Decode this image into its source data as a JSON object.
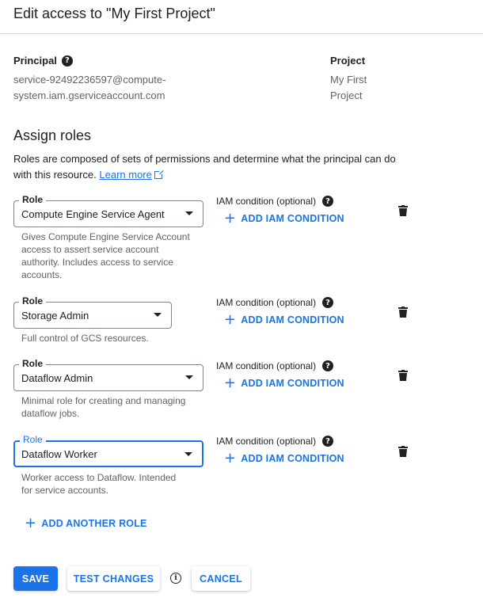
{
  "dialog": {
    "title": "Edit access to \"My First Project\""
  },
  "principal": {
    "label": "Principal",
    "value_line1": "service-92492236597@compute-",
    "value_line2": "system.iam.gserviceaccount.com"
  },
  "project": {
    "label": "Project",
    "value_line1": "My First",
    "value_line2": "Project"
  },
  "assign_roles": {
    "title": "Assign roles",
    "description": "Roles are composed of sets of permissions and determine what the principal can do with this resource.",
    "learn_more": "Learn more"
  },
  "roles": [
    {
      "label": "Role",
      "value": "Compute Engine Service Agent",
      "hint": "Gives Compute Engine Service Account access to assert service account authority. Includes access to service accounts.",
      "iam_label": "IAM condition (optional)",
      "add_condition": "ADD IAM CONDITION"
    },
    {
      "label": "Role",
      "value": "Storage Admin",
      "hint": "Full control of GCS resources.",
      "iam_label": "IAM condition (optional)",
      "add_condition": "ADD IAM CONDITION"
    },
    {
      "label": "Role",
      "value": "Dataflow Admin",
      "hint": "Minimal role for creating and managing dataflow jobs.",
      "iam_label": "IAM condition (optional)",
      "add_condition": "ADD IAM CONDITION"
    },
    {
      "label": "Role",
      "value": "Dataflow Worker",
      "hint": "Worker access to Dataflow. Intended for service accounts.",
      "iam_label": "IAM condition (optional)",
      "add_condition": "ADD IAM CONDITION"
    }
  ],
  "add_another_role": "ADD ANOTHER ROLE",
  "buttons": {
    "save": "SAVE",
    "test_changes": "TEST CHANGES",
    "cancel": "CANCEL"
  },
  "colors": {
    "accent": "#1a73e8",
    "text": "#202124",
    "muted": "#5f6368",
    "border": "#80868b"
  }
}
